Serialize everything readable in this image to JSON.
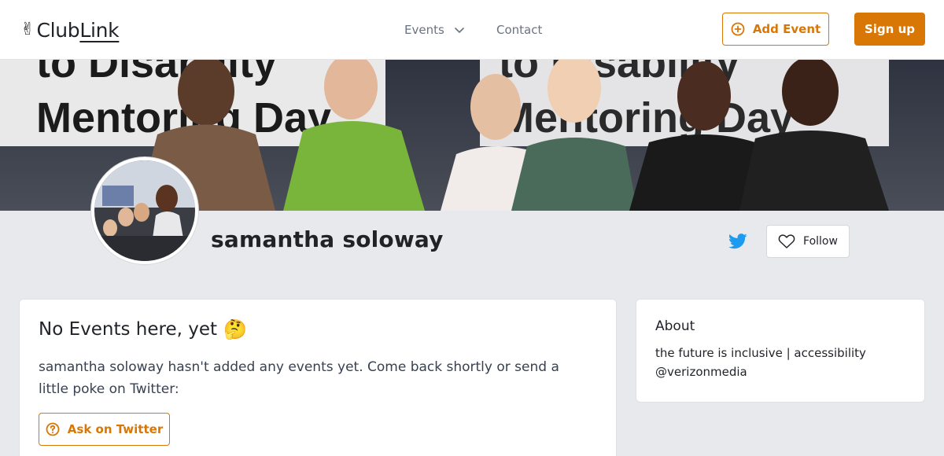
{
  "header": {
    "logo_hand": "✌",
    "logo_club": "Club",
    "logo_link": "Link",
    "nav_events": "Events",
    "nav_contact": "Contact",
    "add_event_label": "Add Event",
    "sign_up_label": "Sign up"
  },
  "banner": {
    "sign_line1": "to Disability",
    "sign_line2": "Mentoring Day",
    "sign2_line1": "to Disability",
    "sign2_line2": "Mentoring Day"
  },
  "profile": {
    "name": "samantha soloway",
    "follow_label": "Follow"
  },
  "events_card": {
    "title": "No Events here, yet",
    "emoji": "🤔",
    "description": "samantha soloway hasn't added any events yet. Come back shortly or send a little poke on Twitter:",
    "ask_label": "Ask on Twitter"
  },
  "about_card": {
    "title": "About",
    "text": "the future is inclusive | accessibility @verizonmedia"
  },
  "colors": {
    "accent": "#d97706",
    "twitter": "#1d9bf0",
    "page_bg": "#e8e9ed"
  },
  "icons": [
    "victory-hand-icon",
    "chevron-down-icon",
    "plus-circle-icon",
    "twitter-icon",
    "heart-icon",
    "question-circle-icon"
  ]
}
